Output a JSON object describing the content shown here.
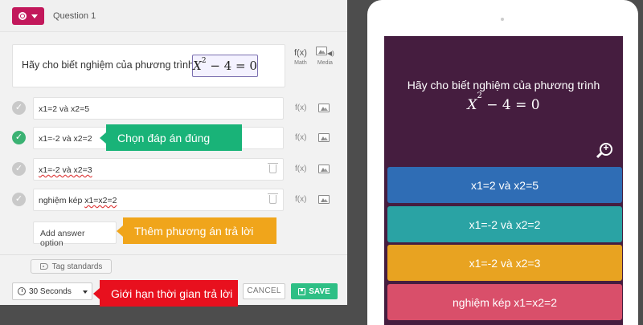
{
  "editor": {
    "question_label": "Question 1",
    "question_text": "Hãy cho biết nghiệm của phương trình",
    "formula": {
      "base": "X",
      "exp": "2",
      "rest": "− 4 = 0"
    },
    "math_tool": {
      "symbol": "f(x)",
      "label": "Math"
    },
    "media_tool": {
      "label": "Media"
    },
    "answers": [
      {
        "text": "x1=2 và x2=5",
        "correct": false,
        "trash": false
      },
      {
        "text": "x1=-2 và x2=2",
        "correct": true,
        "trash": false
      },
      {
        "text": "x1=-2 và x2=3",
        "correct": false,
        "trash": true
      },
      {
        "pre": "nghiệm kép ",
        "u": "x1=x2=2",
        "correct": false,
        "trash": true
      }
    ],
    "answer_fx": "f(x)",
    "add_option": "Add answer option",
    "tag_standards": "Tag standards",
    "time_value": "30 Seconds",
    "cancel": "CANCEL",
    "save": "SAVE"
  },
  "callouts": {
    "correct": "Chọn đáp án đúng",
    "add": "Thêm phương án trả lời",
    "time": "Giới hạn thời gian trả lời"
  },
  "preview": {
    "question": "Hãy cho biết nghiệm của phương trình",
    "formula": {
      "base": "X",
      "exp": "2",
      "rest": "− 4 = 0"
    },
    "options": [
      {
        "text": "x1=2 và x2=5",
        "color": "#2f6db5"
      },
      {
        "text": "x1=-2 và x2=2",
        "color": "#2aa3a4"
      },
      {
        "text": "x1=-2 và x2=3",
        "color": "#e8a321"
      },
      {
        "text": "nghiệm kép x1=x2=2",
        "color": "#d94f6a"
      }
    ]
  },
  "colors": {
    "primary": "#c2185b",
    "correct": "#3bb273",
    "save": "#2ebf85",
    "preview_bg": "#451d3f"
  }
}
